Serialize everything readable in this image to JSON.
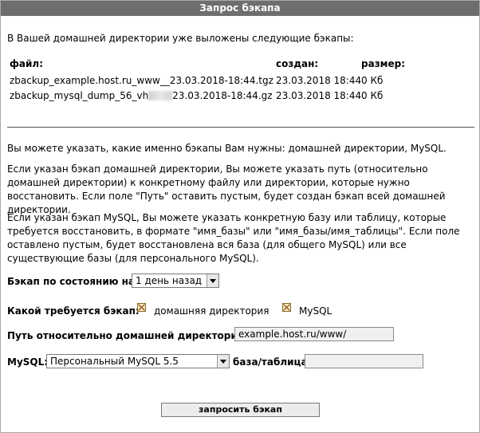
{
  "title": "Запрос бэкапа",
  "intro": "В Вашей домашней директории уже выложены следующие бэкапы:",
  "table": {
    "headers": {
      "file": "файл:",
      "created": "создан:",
      "size": "размер:"
    },
    "rows": [
      {
        "file": "zbackup_example.host.ru_www__23.03.2018-18:44.tgz",
        "created": "23.03.2018 18:44",
        "size": "0 Кб"
      },
      {
        "file_prefix": "zbackup_mysql_dump_56_vh",
        "file_suffix": "23.03.2018-18:44.gz",
        "created": "23.03.2018 18:44",
        "size": "0 Кб"
      }
    ]
  },
  "info": {
    "p1": "Вы можете указать, какие именно бэкапы Вам нужны: домашней директории, MySQL.",
    "p2": "Если указан бэкап домашней директории, Вы можете указать путь (относительно домашней директории) к конкретному файлу или директории, которые нужно восстановить. Если поле \"Путь\" оставить пустым, будет создан бэкап всей домашней директории.",
    "p3": "Если указан бэкап MySQL, Вы можете указать конкретную базу или таблицу, которые требуется восстановить, в формате \"имя_базы\" или \"имя_базы/имя_таблицы\". Если поле оставлено пустым, будет восстановлена вся база (для общего MySQL) или все существующие базы (для персонального MySQL)."
  },
  "form": {
    "state_label": "Бэкап по состоянию на:",
    "state_value": "1 день назад",
    "type_label": "Какой требуется бэкап:",
    "type_home": "домашняя директория",
    "type_mysql": "MySQL",
    "path_label": "Путь относительно домашней директории:",
    "path_value": "example.host.ru/www/",
    "mysql_label": "MySQL:",
    "mysql_value": "Персональный MySQL 5.5",
    "db_label": "база/таблица:",
    "db_value": "",
    "submit_label": "запросить бэкап"
  }
}
